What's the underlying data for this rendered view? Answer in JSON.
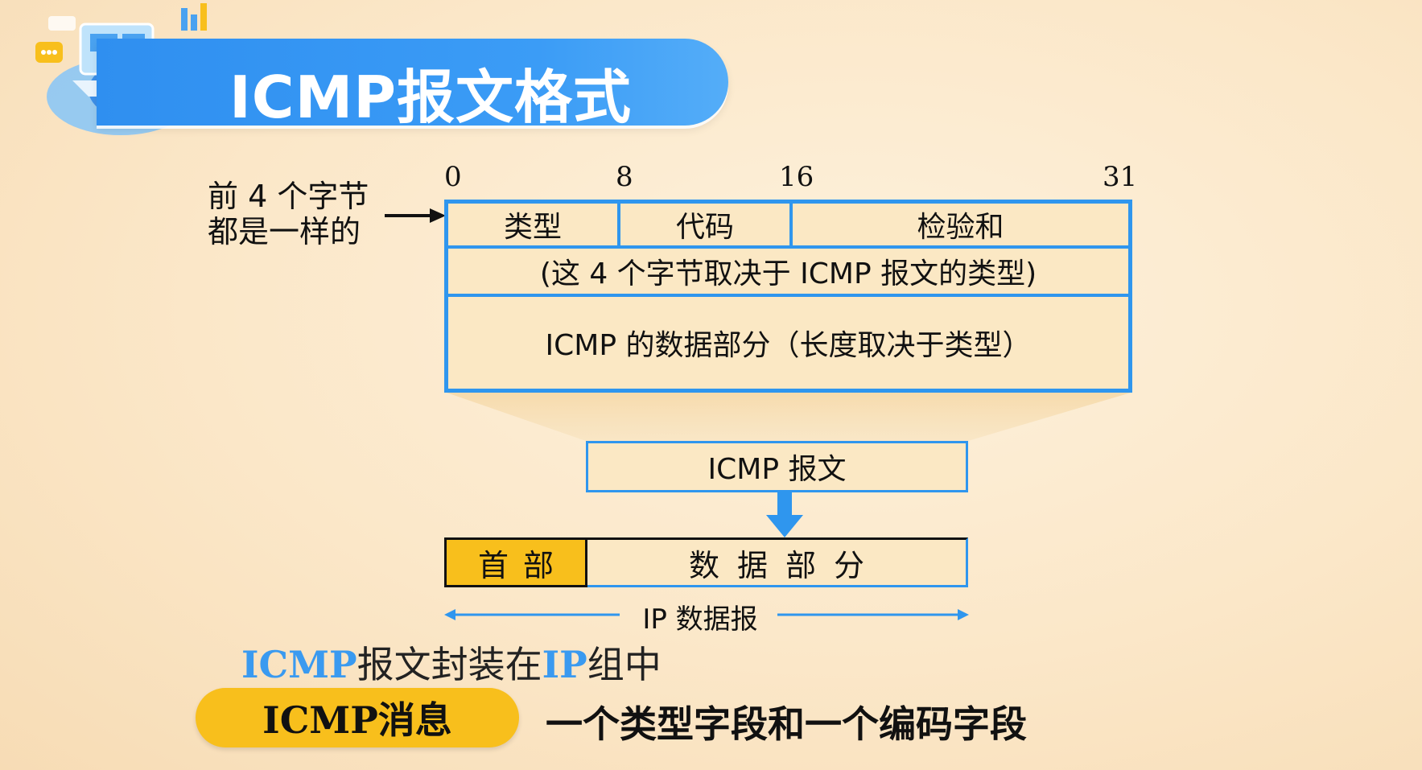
{
  "title": "ICMP报文格式",
  "bit_ruler": {
    "b0": "0",
    "b8": "8",
    "b16": "16",
    "b31": "31"
  },
  "side_note": {
    "line1": "前 4 个字节",
    "line2": "都是一样的"
  },
  "format": {
    "type": "类型",
    "code": "代码",
    "checksum": "检验和",
    "row2": "(这 4 个字节取决于 ICMP 报文的类型)",
    "data": "ICMP 的数据部分（长度取决于类型）"
  },
  "icmp_message_label": "ICMP 报文",
  "ip_datagram": {
    "header": "首部",
    "data": "数据部分",
    "label": "IP 数据报"
  },
  "encapsulation": {
    "part1": "ICMP",
    "part2": "报文封装在",
    "part3": "IP",
    "part4": "组中"
  },
  "message_pill": "ICMP消息",
  "message_desc": "一个类型字段和一个编码字段",
  "colors": {
    "accent_blue": "#2f96ee",
    "highlight_yellow": "#f8bf1c",
    "box_fill": "#fbe8c4"
  }
}
